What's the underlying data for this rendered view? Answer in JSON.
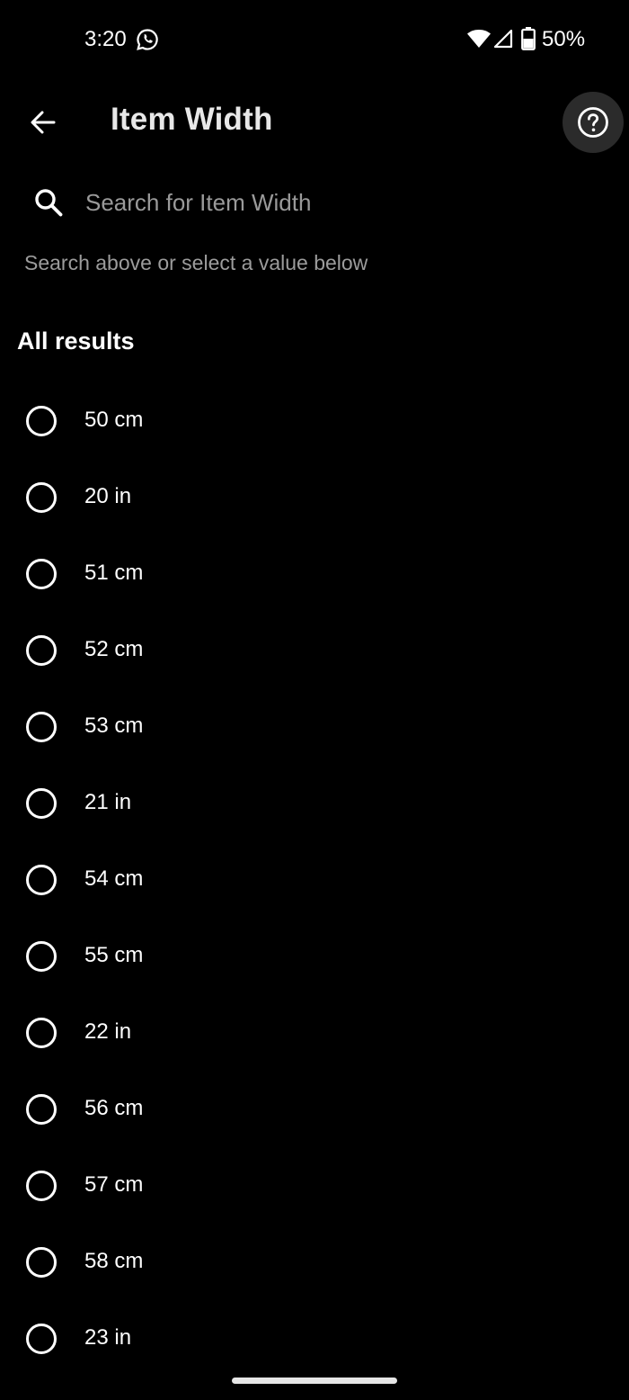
{
  "status_bar": {
    "time": "3:20",
    "battery_percent": "50%",
    "icons": [
      "whatsapp-icon",
      "wifi-icon",
      "cell-signal-icon",
      "battery-icon"
    ]
  },
  "header": {
    "title": "Item Width",
    "back_icon": "arrow-left-icon",
    "help_icon": "question-circle-icon"
  },
  "search": {
    "placeholder": "Search for Item Width",
    "value": "",
    "icon": "search-icon"
  },
  "helper_text": "Search above or select a value below",
  "section_title": "All results",
  "options": [
    {
      "label": "50 cm"
    },
    {
      "label": "20 in"
    },
    {
      "label": "51 cm"
    },
    {
      "label": "52 cm"
    },
    {
      "label": "53 cm"
    },
    {
      "label": "21 in"
    },
    {
      "label": "54 cm"
    },
    {
      "label": "55 cm"
    },
    {
      "label": "22 in"
    },
    {
      "label": "56 cm"
    },
    {
      "label": "57 cm"
    },
    {
      "label": "58 cm"
    },
    {
      "label": "23 in"
    }
  ],
  "colors": {
    "background": "#000000",
    "text": "#ffffff",
    "muted_text": "#9c9c9c",
    "help_button_bg": "#2b2b2b"
  }
}
